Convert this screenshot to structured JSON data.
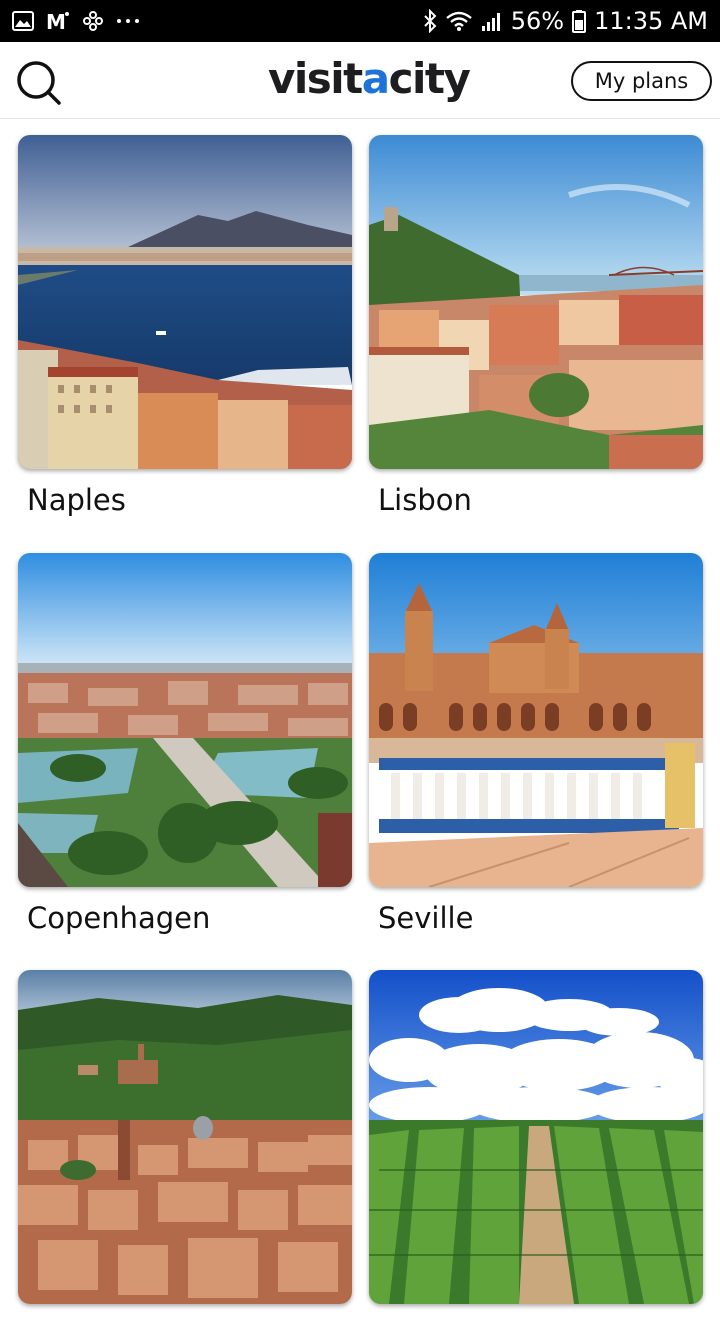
{
  "status_bar": {
    "left_icons": [
      "image-icon",
      "gmail-icon",
      "pinwheel-icon",
      "more-dots-icon"
    ],
    "battery_percent": "56%",
    "time": "11:35 AM"
  },
  "header": {
    "logo_prefix": "visit",
    "logo_accent": "a",
    "logo_suffix": "city",
    "my_plans_label": "My plans",
    "accent_color": "#1e73d8"
  },
  "cities": [
    {
      "name": "Naples"
    },
    {
      "name": "Lisbon"
    },
    {
      "name": "Copenhagen"
    },
    {
      "name": "Seville"
    },
    {
      "name": ""
    },
    {
      "name": ""
    }
  ]
}
